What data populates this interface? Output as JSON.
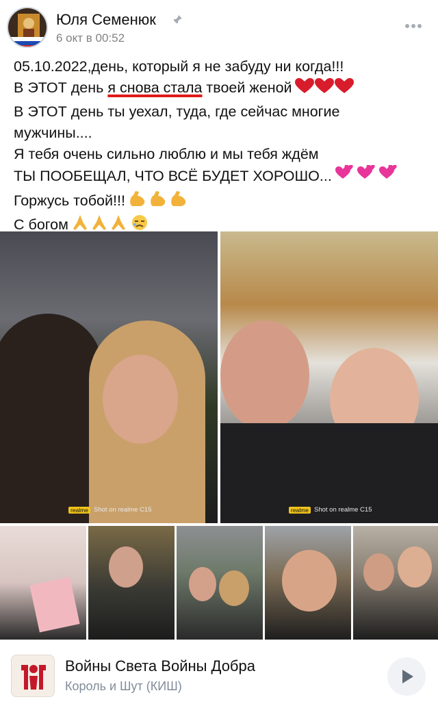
{
  "post": {
    "author": "Юля Семенюк",
    "date": "6 окт в 00:52",
    "avatar_icon": "icon-avatar",
    "pin_icon": "pin-icon",
    "more_icon": "more-dots-icon",
    "text": {
      "line1": "05.10.2022,день, который я не забуду ни когда!!!",
      "line2_pre": "В ЭТОТ день ",
      "line2_underlined": "я снова стала",
      "line2_post": " твоей женой",
      "line3": "В ЭТОТ день ты уехал, туда, где сейчас многие",
      "line4": "мужчины....",
      "line5": "Я тебя очень сильно люблю и мы тебя ждём",
      "line6": "ТЫ ПООБЕЩАЛ, ЧТО ВСЁ БУДЕТ ХОРОШО...",
      "line7": "Горжусь тобой!!!",
      "line8": "С богом"
    },
    "emoji": {
      "hearts": "red-heart-icon",
      "pink_hearts": "two-hearts-icon",
      "muscles": "flexed-biceps-icon",
      "pray": "folded-hands-icon",
      "sad": "sad-face-icon"
    },
    "accent_underline": "#e01a1a"
  },
  "photos": {
    "watermark_brand": "realme",
    "watermark_text": "Shot on realme C15",
    "items": [
      {
        "label": "photo-kiss"
      },
      {
        "label": "photo-selfie-tree"
      },
      {
        "label": "photo-certificate"
      },
      {
        "label": "photo-bench"
      },
      {
        "label": "photo-couple-road"
      },
      {
        "label": "photo-woman-selfie"
      },
      {
        "label": "photo-couple-close"
      }
    ]
  },
  "audio": {
    "title": "Войны Света Войны Добра",
    "artist": "Король и Шут (КИШ)",
    "play_icon": "play-icon",
    "cover_icon": "album-cover-icon"
  }
}
